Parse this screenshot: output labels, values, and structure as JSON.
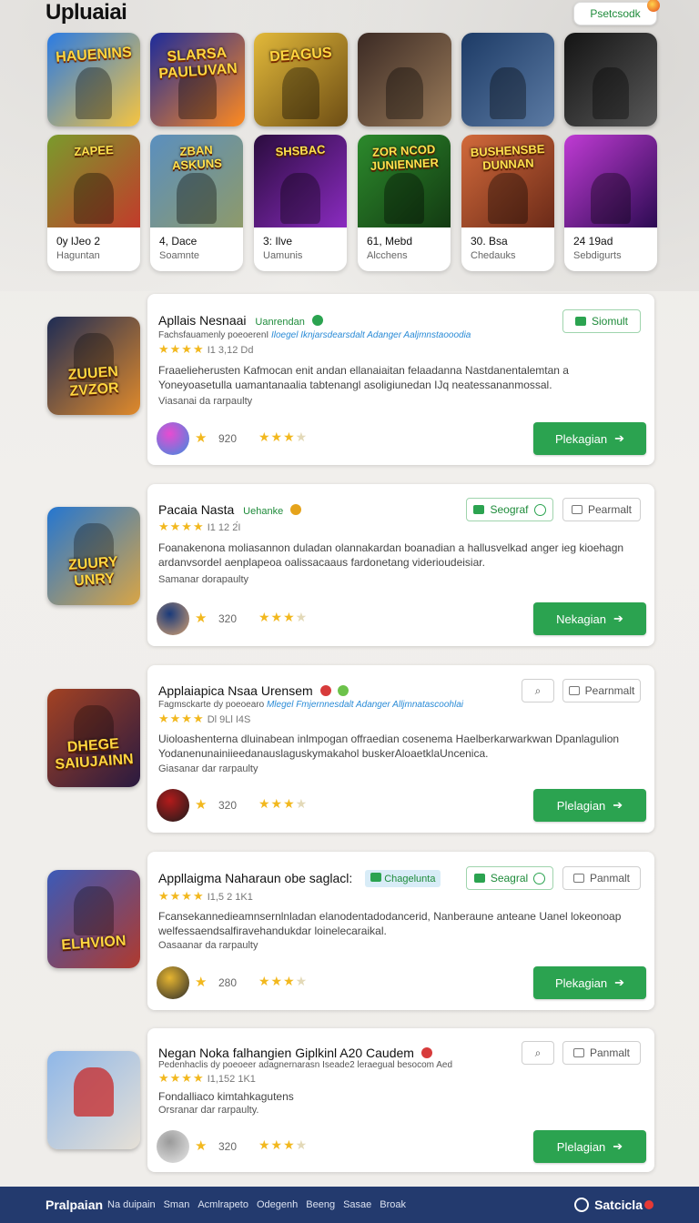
{
  "page": {
    "title": "Upluaiai",
    "top_chip": "Psetcsodk"
  },
  "colors": {
    "accent": "#2ba350",
    "footer": "#233a6e",
    "star": "#f2b81e"
  },
  "grid_row1": [
    {
      "art_text": "HAUENINS",
      "bg": [
        "#2a7be4",
        "#f6c440"
      ]
    },
    {
      "art_text": "SLARSA PAULUVAN",
      "bg": [
        "#1c2b9b",
        "#ff8a1f"
      ]
    },
    {
      "art_text": "DEAGUS",
      "bg": [
        "#e2b93a",
        "#6d4d14"
      ]
    },
    {
      "art_text": "",
      "bg": [
        "#3b2a24",
        "#9a7b5a"
      ]
    },
    {
      "art_text": "",
      "bg": [
        "#1d3b66",
        "#5b7aa3"
      ]
    },
    {
      "art_text": "",
      "bg": [
        "#141414",
        "#585858"
      ]
    }
  ],
  "grid_row2": [
    {
      "art_text": "ZAPEE",
      "title": "0y lJeo 2",
      "sub": "Haguntan",
      "bg": [
        "#7a9b2c",
        "#c23b2b"
      ]
    },
    {
      "art_text": "ZBAN ASKUNS",
      "title": "4, Dace",
      "sub": "Soamnte",
      "bg": [
        "#5a8fbf",
        "#8e9a6a"
      ]
    },
    {
      "art_text": "SHSBAC",
      "title": "3: Ilve",
      "sub": "Uamunis",
      "bg": [
        "#2a0c3d",
        "#8a2bc0"
      ]
    },
    {
      "art_text": "ZOR NCOD JUNIENNER",
      "title": "61, Mebd",
      "sub": "Alcchens",
      "bg": [
        "#2c8a2c",
        "#133a12"
      ]
    },
    {
      "art_text": "BUSHENSBE DUNNAN",
      "title": "30. Bsa",
      "sub": "Chedauks",
      "bg": [
        "#d26a3b",
        "#6b2a18"
      ]
    },
    {
      "art_text": "",
      "title": "24 19ad",
      "sub": "Sebdigurts",
      "bg": [
        "#c03bd4",
        "#2c0b52"
      ]
    }
  ],
  "cards": [
    {
      "art_text": "ZUUEN ZVZOR",
      "icon_bg": [
        "#1e2c55",
        "#e08a2b"
      ],
      "title": "Apllais Nesnaai",
      "tag": "Uanrendan",
      "badge_color": "#2ba350",
      "meta_prefix": "Fachsfauamenly poeoerenI",
      "meta_blue": "Iloegel Iknjarsdearsdalt Adanger Aaljmnstaooodia",
      "rating_text": "I1 3,12 Dd",
      "desc": "Fraaelieherusten Kafmocan enit andan ellanaiaitan felaadanna Nastdanentalemtan a Yoneyoasetulla uamantanaalia tabtenangl asoligiunedan IJq neatessananmossal.",
      "sub": "Viasanai da rarpaulty",
      "count": "920",
      "cta": "Plekagian",
      "pills": [
        {
          "label": "Siomult",
          "style": "green",
          "icon": "square"
        }
      ],
      "avatar_bg": [
        "#e84bd1",
        "#3b8de0"
      ]
    },
    {
      "art_text": "ZUURY UNRY",
      "icon_bg": [
        "#2476d1",
        "#d9a545"
      ],
      "title": "Pacaia Nasta",
      "tag": "Uehanke",
      "badge_color": "#e5a31b",
      "meta_prefix": "",
      "meta_blue": "",
      "rating_text": "I1 12 2́I",
      "desc": "Foanakenona moliasannon duladan olannakardan boanadian a hallusvelkad anger ieg kioehagn ardanvsordel aenplapeoa oalissacaaus fardonetang viderioudeisiar.",
      "sub": "Samanar dorapaulty",
      "count": "320",
      "cta": "Nekagian",
      "pills": [
        {
          "label": "Seograf",
          "style": "green",
          "icon": "square-circle"
        },
        {
          "label": "Pearmalt",
          "style": "grey",
          "icon": "outline"
        }
      ],
      "avatar_bg": [
        "#1a3a7a",
        "#d4a070"
      ]
    },
    {
      "art_text": "DHEGE SAIUJAINN",
      "icon_bg": [
        "#a34223",
        "#2a1a40"
      ],
      "title": "Applaiapica Nsaa Urensem",
      "tag": "",
      "badge_color": "#d73b3b",
      "meta_prefix": "Fagmsckarte dy poeoearo",
      "meta_blue": "Mlegel Fmjernnesdalt Adanger Alljmnatascoohlai",
      "rating_text": "Dl 9Ll I4S",
      "desc": "Uioloashenterna dluinabean inlmpogan offraedian cosenema Haelberkarwarkwan Dpanlagulion Yodanenunainiieedanauslaguskymakahol buskerAloaetklaUncenica.",
      "sub": "Giasanar dar rarpaulty",
      "count": "320",
      "cta": "Plelagian",
      "pills": [
        {
          "label": "",
          "style": "grey",
          "icon": "search"
        },
        {
          "label": "Pearnmalt",
          "style": "grey",
          "icon": "outline"
        }
      ],
      "avatar_bg": [
        "#b31b1b",
        "#1b1b1b"
      ]
    },
    {
      "art_text": "ELHVION",
      "icon_bg": [
        "#3b5ab8",
        "#b03a2e"
      ],
      "title": "Appllaigma Naharaun obe saglacl:",
      "tag": "",
      "chip": "Chagelunta",
      "badge_color": "",
      "meta_prefix": "",
      "meta_blue": "",
      "rating_text": "I1,5 2 1K1",
      "desc": "Fcansekannedieamnsernlnladan elanodentadodancerid, Nanberaune anteane Uanel lokeonoap welfessaendsalfiravehandukdar loinelecaraikal.",
      "sub": "Oasaanar da rarpaulty",
      "count": "280",
      "cta": "Plekagian",
      "pills": [
        {
          "label": "Seagral",
          "style": "green",
          "icon": "square-circle"
        },
        {
          "label": "Panmalt",
          "style": "grey",
          "icon": "outline"
        }
      ],
      "avatar_bg": [
        "#e6b530",
        "#2a2a2a"
      ]
    },
    {
      "art_text": "",
      "icon_bg": [
        "#8fb7e8",
        "#e6e0d6"
      ],
      "title": "Negan Noka falhangien Giplkinl A20 Caudem",
      "tag": "",
      "badge_color": "#d73b3b",
      "meta_prefix": "Pedenhaclis dy poeoeer adagnernarasn Iseade2 leraegual besocom Aed",
      "meta_blue": "",
      "rating_text": "I1,152 1K1",
      "desc": "Fondalliaco kimtahkagutens",
      "sub": "Orsranar dar rarpaulty.",
      "count": "320",
      "cta": "Plelagian",
      "pills": [
        {
          "label": "",
          "style": "grey",
          "icon": "search"
        },
        {
          "label": "Panmalt",
          "style": "grey",
          "icon": "outline"
        }
      ],
      "avatar_bg": [
        "#9a9a9a",
        "#e8e8e8"
      ]
    }
  ],
  "footer": {
    "brand": "Pralpaian",
    "links": [
      "Na duipain",
      "Sman",
      "Acmlrapeto",
      "Odegenh",
      "Beeng",
      "Sasae",
      "Broak"
    ],
    "right": "Satcicla"
  }
}
